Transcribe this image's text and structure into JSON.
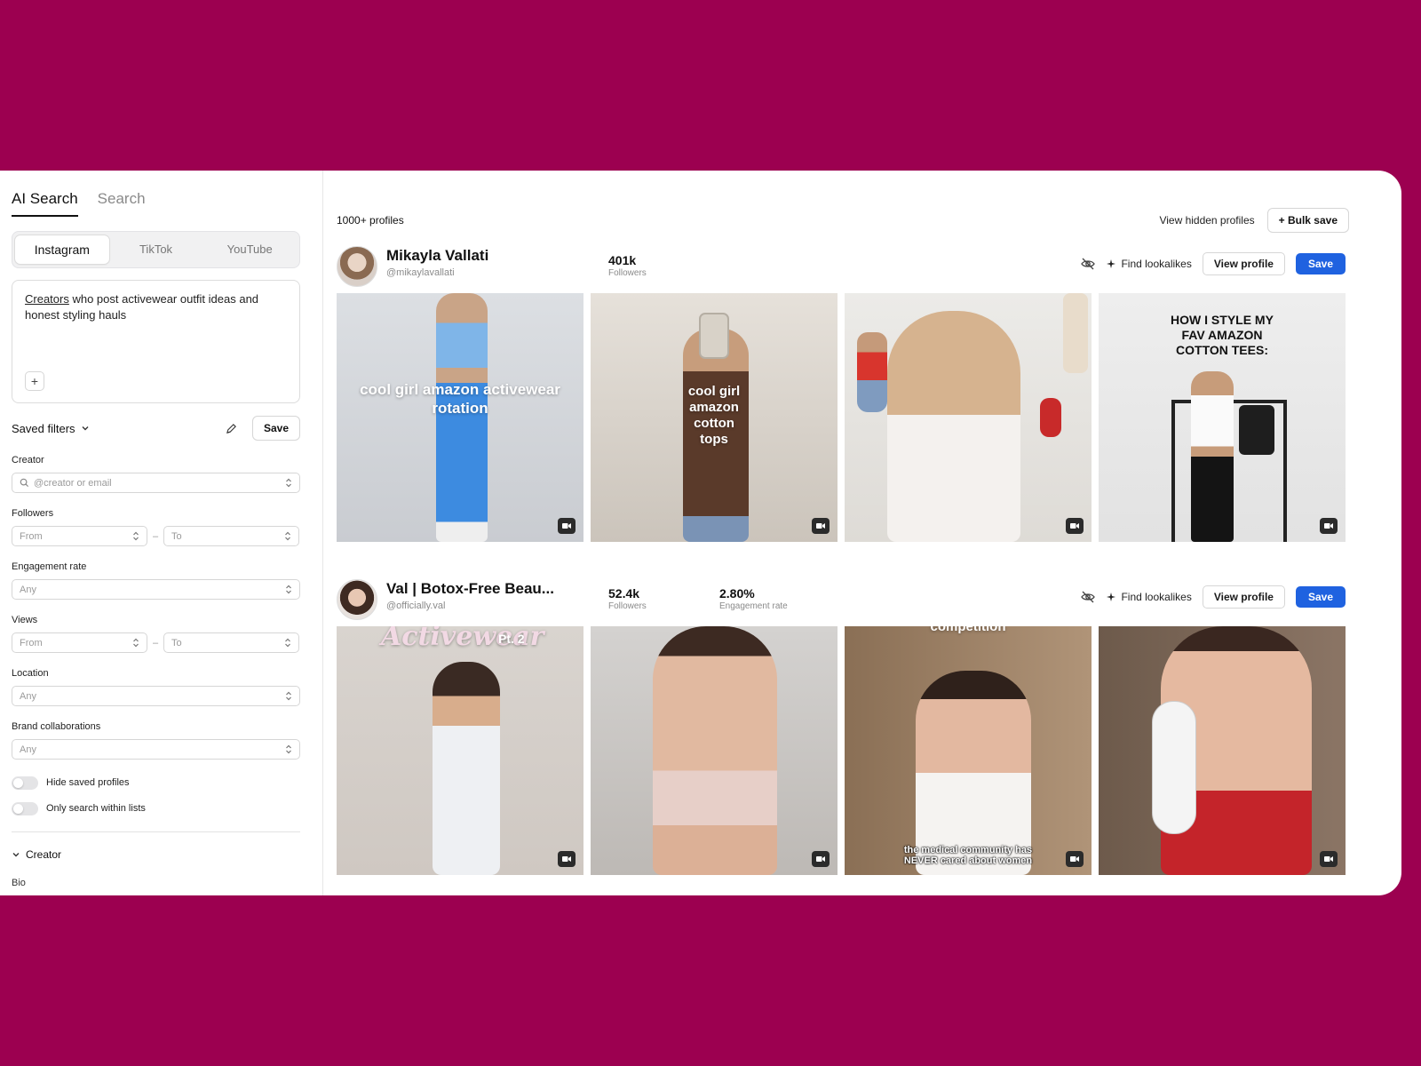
{
  "sidebar": {
    "tabs": [
      {
        "label": "AI Search",
        "active": true
      },
      {
        "label": "Search",
        "active": false
      }
    ],
    "platforms": [
      {
        "label": "Instagram",
        "active": true
      },
      {
        "label": "TikTok",
        "active": false
      },
      {
        "label": "YouTube",
        "active": false
      }
    ],
    "query": {
      "underlined": "Creators",
      "rest": " who post activewear outfit ideas and honest styling hauls"
    },
    "saved_filters_label": "Saved filters",
    "save_label": "Save",
    "creator_label": "Creator",
    "creator_placeholder": "@creator or email",
    "followers_label": "Followers",
    "from_placeholder": "From",
    "to_placeholder": "To",
    "engagement_label": "Engagement rate",
    "any_placeholder": "Any",
    "views_label": "Views",
    "location_label": "Location",
    "brand_label": "Brand collaborations",
    "hide_saved_label": "Hide saved profiles",
    "only_lists_label": "Only search within lists",
    "creator_section_label": "Creator",
    "bio_label": "Bio",
    "range_dash": "–"
  },
  "main": {
    "count": "1000+ profiles",
    "view_hidden": "View hidden profiles",
    "bulk_save": "+ Bulk save",
    "find_lookalikes": "Find lookalikes",
    "view_profile": "View profile",
    "save": "Save",
    "profiles": [
      {
        "name": "Mikayla Vallati",
        "handle": "@mikaylavallati",
        "followers": "401k",
        "followers_label": "Followers",
        "thumbs": [
          {
            "caption": "cool girl amazon activewear rotation"
          },
          {
            "caption": "cool girl amazon cotton tops"
          },
          {
            "caption": ""
          },
          {
            "caption": "HOW I STYLE MY FAV AMAZON COTTON TEES:"
          }
        ]
      },
      {
        "name": "Val | Botox-Free Beau...",
        "handle": "@officially.val",
        "followers": "52.4k",
        "followers_label": "Followers",
        "engagement": "2.80%",
        "engagement_label": "Engagement rate",
        "thumbs": [
          {
            "caption": "Activewear",
            "sub": "Pt. 2"
          },
          {
            "caption": ""
          },
          {
            "caption": "competition",
            "sub": "the medical community has NEVER cared about women"
          },
          {
            "caption": ""
          }
        ]
      }
    ]
  },
  "colors": {
    "background": "#9c0050",
    "primary": "#1f62e0"
  }
}
